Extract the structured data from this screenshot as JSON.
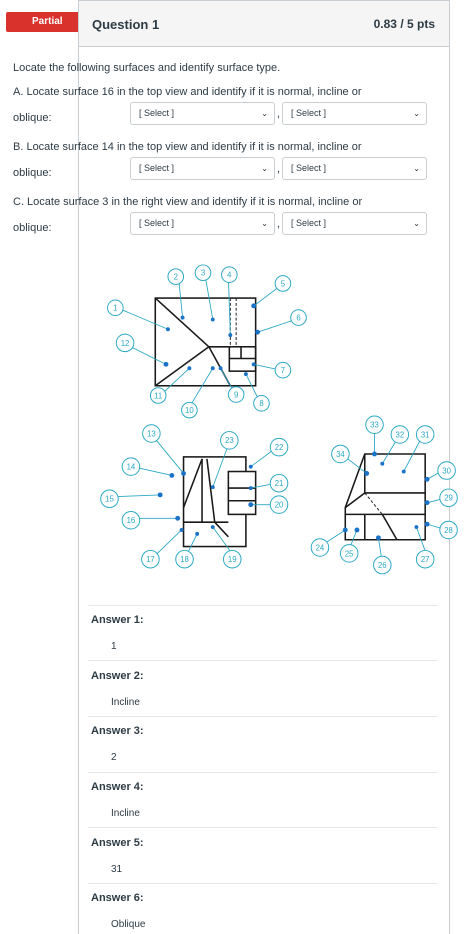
{
  "status_badge": "Partial",
  "question": {
    "title": "Question 1",
    "points": "0.83 / 5 pts",
    "intro": "Locate the following surfaces and identify surface type.",
    "parts": [
      {
        "line1": "A. Locate surface 16 in the top view and identify if it is normal, incline or",
        "line2": "oblique:",
        "select1": "[ Select ]",
        "select2": "[ Select ]"
      },
      {
        "line1": "B. Locate surface 14 in the top view and identify if it is normal, incline or",
        "line2": "oblique:",
        "select1": "[ Select ]",
        "select2": "[ Select ]"
      },
      {
        "line1": "C. Locate surface 3 in the right view and identify if it is normal, incline or",
        "line2": "oblique:",
        "select1": "[ Select ]",
        "select2": "[ Select ]"
      }
    ],
    "comma": ",",
    "chevron": "⌄"
  },
  "drawing": {
    "callouts": [
      "1",
      "2",
      "3",
      "4",
      "5",
      "6",
      "7",
      "8",
      "9",
      "10",
      "11",
      "12",
      "13",
      "14",
      "15",
      "16",
      "17",
      "18",
      "19",
      "20",
      "21",
      "22",
      "23",
      "24",
      "25",
      "26",
      "27",
      "28",
      "29",
      "30",
      "31",
      "32",
      "33",
      "34"
    ],
    "line_color": "#1a1a1a",
    "callout_color": "#2aa8c4",
    "arrow_color": "#1a73c8"
  },
  "answers": [
    {
      "label": "Answer 1:",
      "value": "1"
    },
    {
      "label": "Answer 2:",
      "value": "Incline"
    },
    {
      "label": "Answer 3:",
      "value": "2"
    },
    {
      "label": "Answer 4:",
      "value": "Incline"
    },
    {
      "label": "Answer 5:",
      "value": "31"
    },
    {
      "label": "Answer 6:",
      "value": "Oblique"
    }
  ]
}
